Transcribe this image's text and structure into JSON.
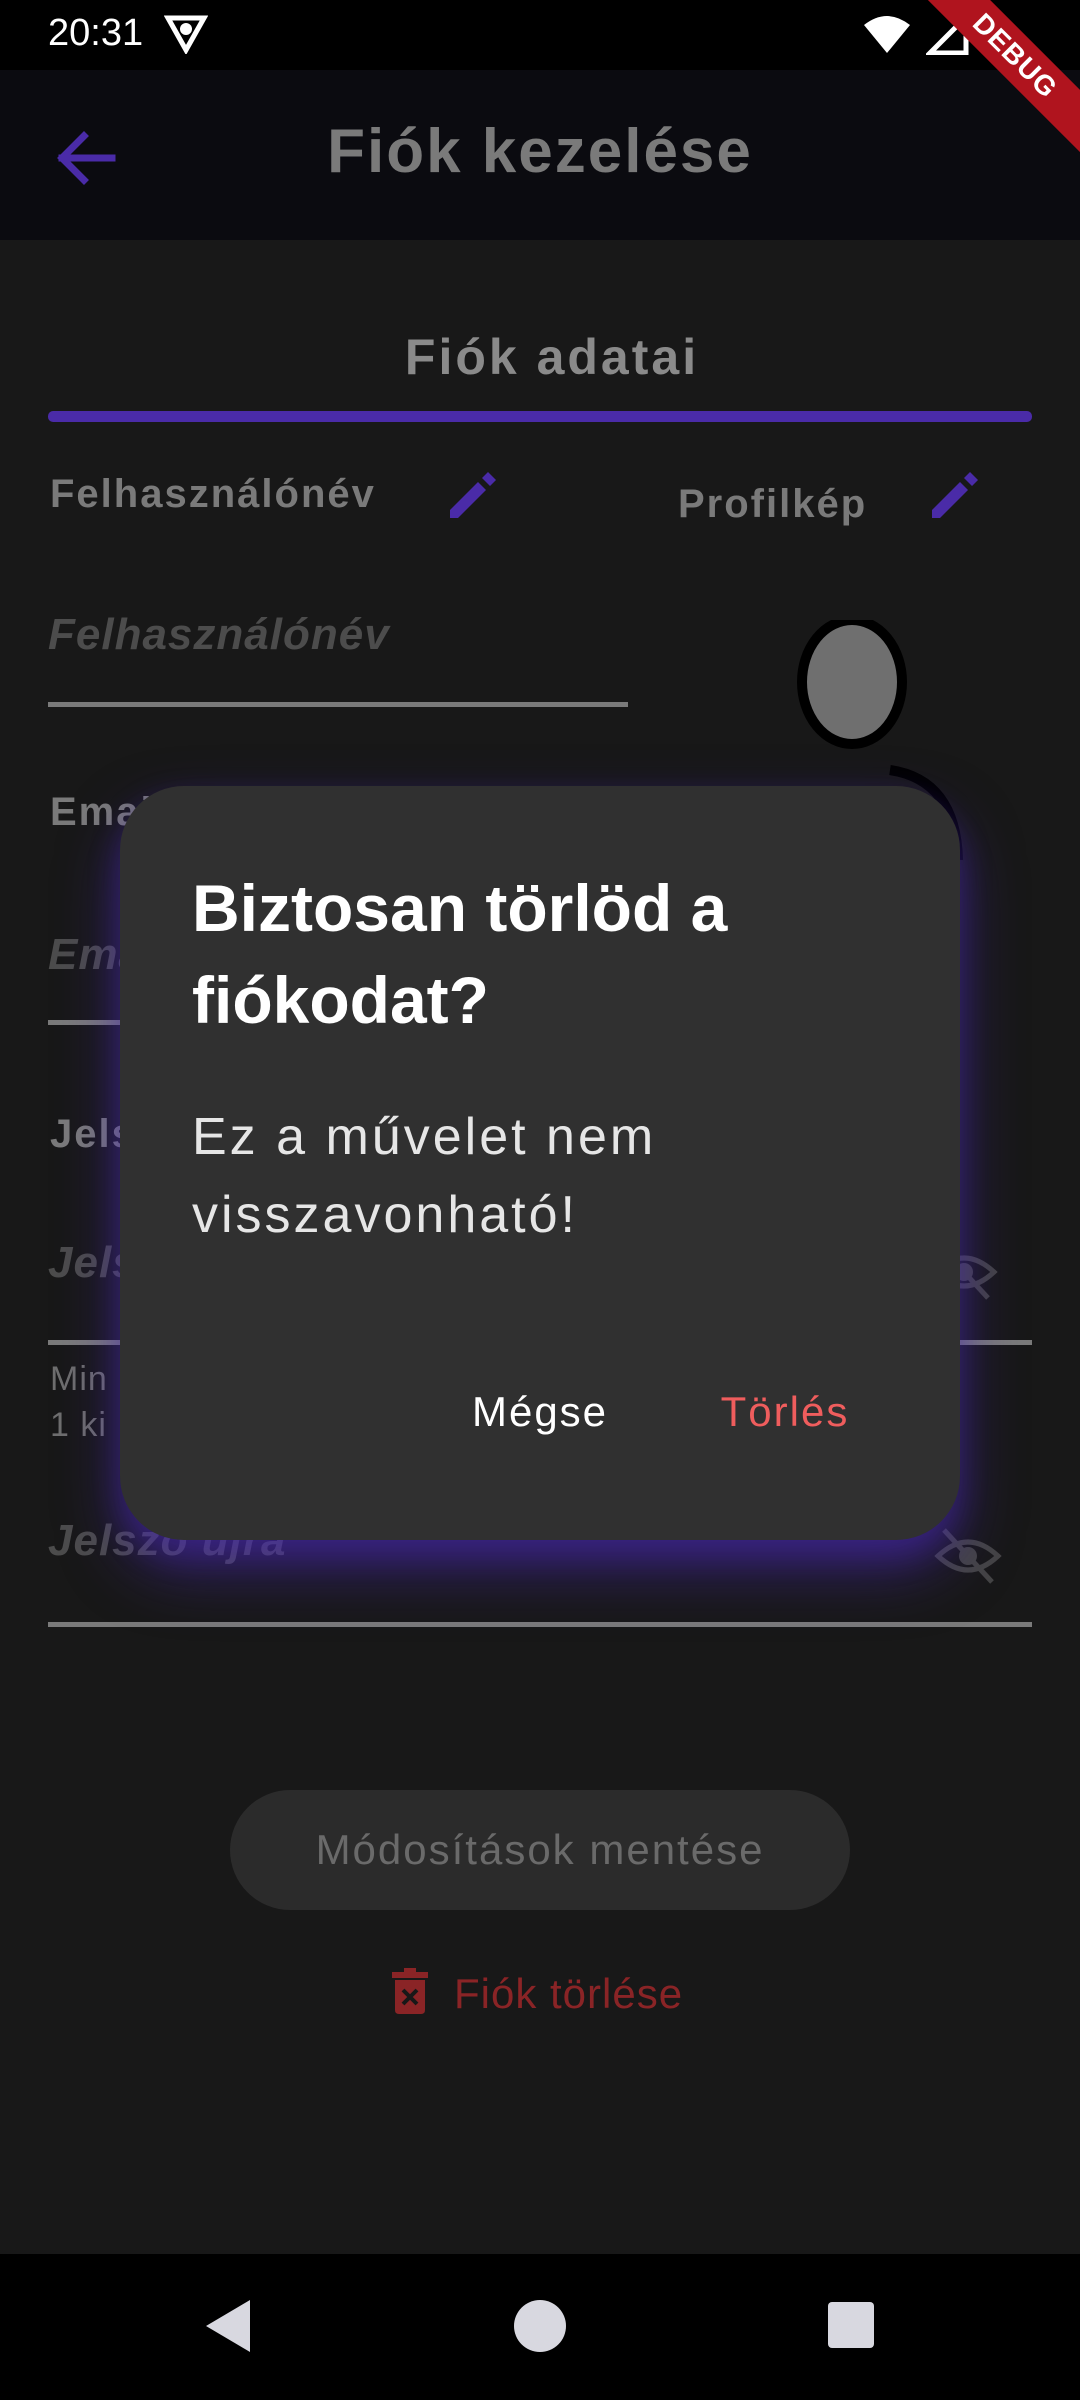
{
  "status_bar": {
    "time": "20:31",
    "debug_label": "DEBUG"
  },
  "app_bar": {
    "title": "Fiók kezelése"
  },
  "tab": {
    "label": "Fiók adatai"
  },
  "form": {
    "username_label": "Felhasználónév",
    "username_placeholder": "Felhasználónév",
    "profile_picture_label": "Profilkép",
    "email_label": "Email",
    "email_placeholder": "Email",
    "password_label": "Jelszó",
    "password_placeholder": "Jelszó",
    "password_helper_line1": "Min",
    "password_helper_line2": "1 ki",
    "password_again_placeholder": "Jelszó újra"
  },
  "actions": {
    "save_label": "Módosítások mentése",
    "delete_account_label": "Fiók törlése"
  },
  "dialog": {
    "title": "Biztosan törlöd a fiókodat?",
    "body": "Ez a művelet nem visszavonható!",
    "cancel_label": "Mégse",
    "confirm_label": "Törlés"
  },
  "colors": {
    "accent": "#4a2ba8",
    "danger": "#ef5d5d",
    "dialog_bg": "#303030",
    "background": "#181818"
  },
  "icons": {
    "back": "arrow-left-icon",
    "edit": "pencil-icon",
    "visibility": "eye-off-icon",
    "delete": "trash-icon",
    "avatar": "person-icon"
  }
}
